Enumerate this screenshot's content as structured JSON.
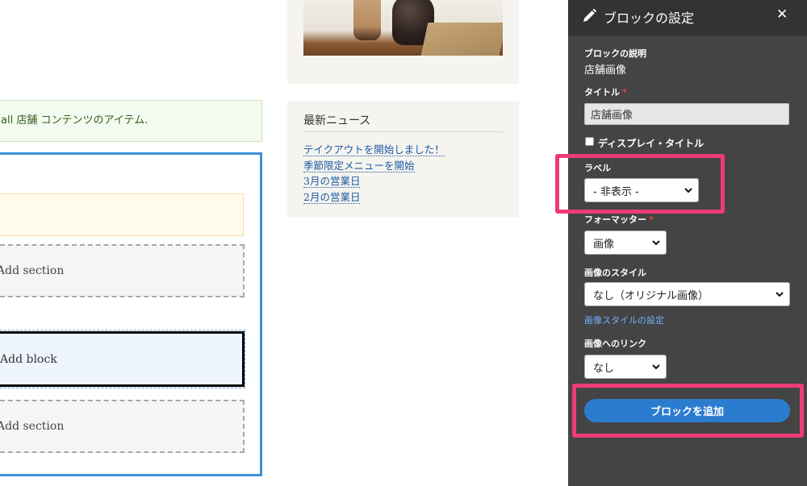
{
  "main": {
    "status_message": "all 店舗 コンテンツのアイテム.",
    "add_section_label_1": "Add section",
    "add_block_label": "Add block",
    "add_section_label_2": "Add section"
  },
  "news": {
    "title": "最新ニュース",
    "items": [
      "テイクアウトを開始しました！",
      "季節限定メニューを開始",
      "3月の営業日",
      "2月の営業日"
    ]
  },
  "tray": {
    "title": "ブロックの設定",
    "description_label": "ブロックの説明",
    "description_value": "店舗画像",
    "title_field_label": "タイトル",
    "title_field_value": "店舗画像",
    "display_title_label": "ディスプレイ・タイトル",
    "label_field_label": "ラベル",
    "label_field_value": "- 非表示 -",
    "formatter_label": "フォーマッター",
    "formatter_value": "画像",
    "image_style_label": "画像のスタイル",
    "image_style_value": "なし（オリジナル画像）",
    "image_style_settings_link": "画像スタイルの設定",
    "image_link_label": "画像へのリンク",
    "image_link_value": "なし",
    "submit_label": "ブロックを追加",
    "required_marker": "*"
  },
  "colors": {
    "tray_background": "#444444",
    "primary_button": "#2b7ccf",
    "highlight": "#ef3b76",
    "region_outline": "#3e8ed6"
  }
}
